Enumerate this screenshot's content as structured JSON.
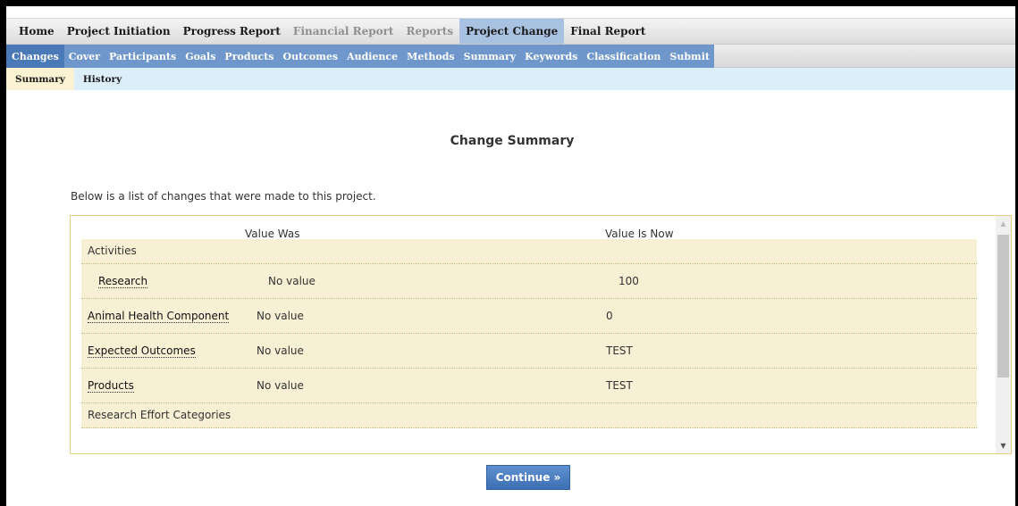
{
  "nav": {
    "primary": [
      {
        "label": "Home",
        "state": "normal"
      },
      {
        "label": "Project Initiation",
        "state": "normal"
      },
      {
        "label": "Progress Report",
        "state": "normal"
      },
      {
        "label": "Financial Report",
        "state": "disabled"
      },
      {
        "label": "Reports",
        "state": "disabled"
      },
      {
        "label": "Project Change",
        "state": "active"
      },
      {
        "label": "Final Report",
        "state": "normal"
      }
    ],
    "secondary": [
      {
        "label": "Changes",
        "state": "active"
      },
      {
        "label": "Cover",
        "state": "normal"
      },
      {
        "label": "Participants",
        "state": "normal"
      },
      {
        "label": "Goals",
        "state": "normal"
      },
      {
        "label": "Products",
        "state": "normal"
      },
      {
        "label": "Outcomes",
        "state": "normal"
      },
      {
        "label": "Audience",
        "state": "normal"
      },
      {
        "label": "Methods",
        "state": "normal"
      },
      {
        "label": "Summary",
        "state": "normal"
      },
      {
        "label": "Keywords",
        "state": "normal"
      },
      {
        "label": "Classification",
        "state": "normal"
      },
      {
        "label": "Submit",
        "state": "normal"
      }
    ],
    "tertiary": [
      {
        "label": "Summary",
        "state": "active"
      },
      {
        "label": "History",
        "state": "normal"
      }
    ]
  },
  "page": {
    "title": "Change Summary",
    "intro": "Below is a list of changes that were made to this project."
  },
  "table": {
    "col_was": "Value Was",
    "col_now": "Value Is Now",
    "rows": [
      {
        "label": "Activities",
        "was": "",
        "now": "",
        "type": "group"
      },
      {
        "label": "Research",
        "was": "No value",
        "now": "100",
        "type": "child"
      },
      {
        "label": "Animal Health Component",
        "was": "No value",
        "now": "0",
        "type": "field"
      },
      {
        "label": "Expected Outcomes",
        "was": "No value",
        "now": "TEST",
        "type": "field"
      },
      {
        "label": "Products",
        "was": "No value",
        "now": "TEST",
        "type": "field"
      },
      {
        "label": "Research Effort Categories",
        "was": "",
        "now": "",
        "type": "group"
      }
    ]
  },
  "actions": {
    "continue": "Continue »"
  },
  "icons": {
    "scroll_up": "triangle-up-icon",
    "scroll_down": "triangle-down-icon"
  },
  "colors": {
    "accent": "#4a79b8",
    "tab_blue": "#6f97cc",
    "row_bg": "#f8f0d4"
  }
}
